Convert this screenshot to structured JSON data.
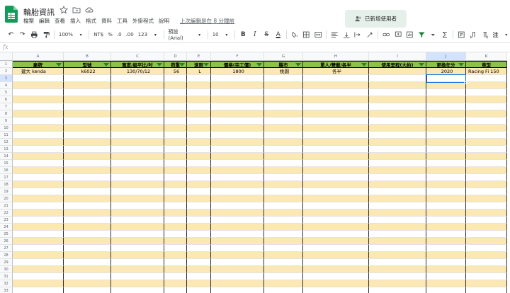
{
  "app": {
    "title": "輪胎資訊",
    "menu": [
      "檔案",
      "編輯",
      "查看",
      "插入",
      "格式",
      "資料",
      "工具",
      "外掛程式",
      "說明"
    ],
    "last_edit": "上次編輯是在 8 分鐘前",
    "share_label": "已新增使用者"
  },
  "toolbar": {
    "zoom": "100%",
    "currency": "NT$",
    "percent": "%",
    "dec_less": ".0",
    "dec_more": ".00",
    "number_fmt": "123",
    "font": "預設 (Arial)",
    "font_size": "10",
    "bold": "B",
    "italic": "I",
    "strike": "S",
    "text_color": "A",
    "more": "注"
  },
  "formula": {
    "fx": "fx",
    "value": ""
  },
  "columns": [
    "A",
    "B",
    "C",
    "D",
    "E",
    "F",
    "G",
    "H",
    "I",
    "J",
    "K"
  ],
  "headers": [
    "廠牌",
    "型號",
    "寬度/扁平比/吋",
    "荷重",
    "速限",
    "價格(完工價)",
    "縣市",
    "單人/雙載/各半",
    "使用里程(大約)",
    "更換年分",
    "車型"
  ],
  "rows": [
    [
      "建大 kenda",
      "k6022",
      "130/70/12",
      "56",
      "L",
      "1800",
      "桃園",
      "各半",
      "",
      "2020",
      "Racing Fi 150"
    ]
  ],
  "row_numbers": [
    "1",
    "2",
    "3",
    "4",
    "5",
    "6",
    "7",
    "8",
    "9",
    "10",
    "11",
    "12",
    "13",
    "14",
    "15",
    "16",
    "17",
    "18",
    "19",
    "20",
    "21",
    "22",
    "23",
    "24",
    "25",
    "26",
    "27",
    "28",
    "29",
    "30",
    "31",
    "32",
    "33"
  ],
  "colors": {
    "header_fill": "#8bc34a",
    "band_yellow": "#fce8b2",
    "band_white": "#ffffff",
    "accent": "#1a73e8"
  }
}
